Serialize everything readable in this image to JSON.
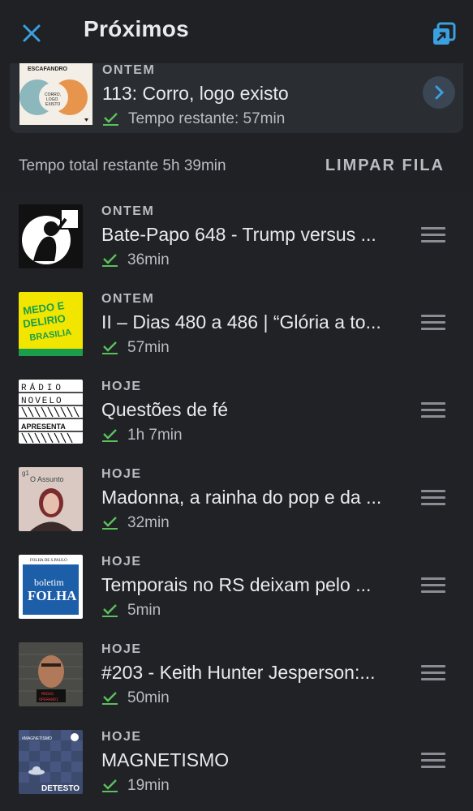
{
  "header": {
    "title": "Próximos"
  },
  "now_playing": {
    "day": "ONTEM",
    "title": "113: Corro, logo existo",
    "duration": "Tempo restante: 57min",
    "art_text": "ESCAFANDRO",
    "art_sub": "CORRO, LOGO EXISTO"
  },
  "summary": {
    "total": "Tempo total restante 5h 39min",
    "clear": "LIMPAR FILA"
  },
  "queue": [
    {
      "day": "ONTEM",
      "title": "Bate-Papo 648 - Trump versus ...",
      "duration": "36min",
      "art": "bate-papo"
    },
    {
      "day": "ONTEM",
      "title": "II – Dias 480 a 486 | “Glória a to...",
      "duration": "57min",
      "art": "medo-delirio"
    },
    {
      "day": "HOJE",
      "title": "Questões de fé",
      "duration": "1h 7min",
      "art": "radio-novelo"
    },
    {
      "day": "HOJE",
      "title": "Madonna, a rainha do pop e da ...",
      "duration": "32min",
      "art": "o-assunto"
    },
    {
      "day": "HOJE",
      "title": "Temporais no RS deixam pelo ...",
      "duration": "5min",
      "art": "boletim-folha"
    },
    {
      "day": "HOJE",
      "title": "#203 - Keith Hunter Jesperson:...",
      "duration": "50min",
      "art": "modus-operandi"
    },
    {
      "day": "HOJE",
      "title": "MAGNETISMO",
      "duration": "19min",
      "art": "detesto"
    }
  ],
  "art_labels": {
    "medo": "MEDO E DELÍRIO EM BRASÍLIA",
    "novelo_1": "RÁDIO",
    "novelo_2": "NOVELO",
    "novelo_3": "APRESENTA",
    "assunto_g1": "g1",
    "assunto": "O Assunto",
    "folha_small": "FOLHA DE S.PAULO",
    "folha_1": "boletim",
    "folha_2": "FOLHA",
    "modus": "MODUS OPERANDI",
    "detesto_tag": "#MAGNETISMO",
    "detesto": "DETESTO"
  },
  "colors": {
    "accent": "#3aa0e0",
    "download": "#5cc05c",
    "background": "#1f2124"
  }
}
